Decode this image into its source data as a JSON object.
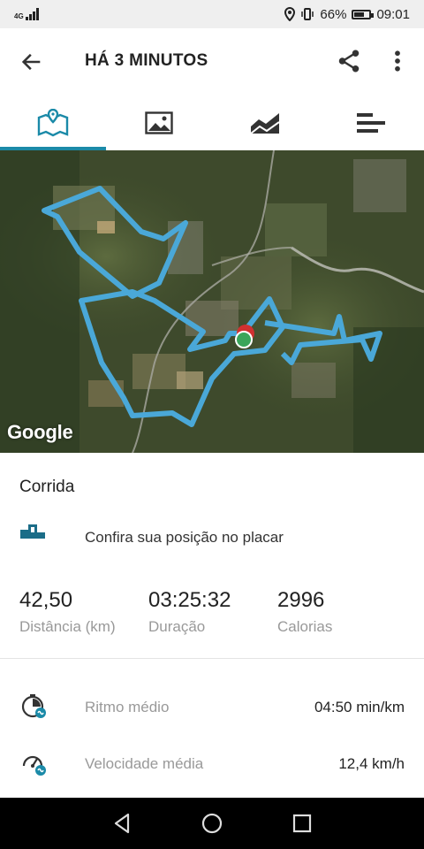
{
  "status": {
    "network": "4G",
    "battery_pct": "66%",
    "time": "09:01",
    "battery_fraction": 0.66
  },
  "appbar": {
    "title": "HÁ 3 MINUTOS"
  },
  "tabs": [
    "map",
    "photos",
    "chart",
    "splits"
  ],
  "map": {
    "attribution": "Google"
  },
  "activity": {
    "type": "Corrida"
  },
  "leaderboard": {
    "label": "Confira sua posição no placar"
  },
  "stats": [
    {
      "value": "42,50",
      "label": "Distância (km)"
    },
    {
      "value": "03:25:32",
      "label": "Duração"
    },
    {
      "value": "2996",
      "label": "Calorias"
    }
  ],
  "metrics": [
    {
      "label": "Ritmo médio",
      "value": "04:50 min/km"
    },
    {
      "label": "Velocidade média",
      "value": "12,4 km/h"
    }
  ],
  "colors": {
    "accent": "#1b8aa8",
    "route": "#4aa8d8",
    "start": "#3aa55a",
    "end": "#d03030"
  }
}
